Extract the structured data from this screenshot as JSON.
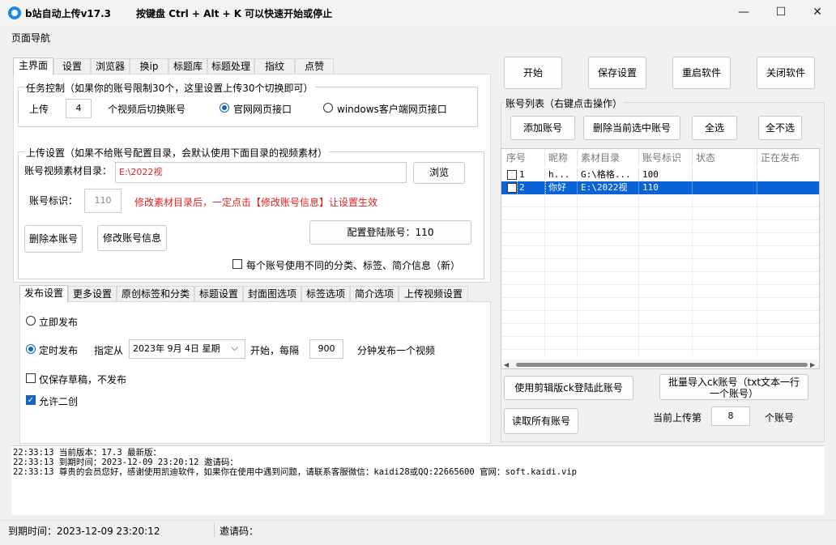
{
  "window": {
    "title": "b站自动上传v17.3",
    "hint": "按键盘 Ctrl + Alt + K  可以快速开始或停止",
    "minimize": "—",
    "maximize": "☐",
    "close": "✕"
  },
  "menu": {
    "nav": "页面导航"
  },
  "top_tabs": [
    "主界面",
    "设置",
    "浏览器",
    "换ip",
    "标题库",
    "标题处理",
    "指纹",
    "点赞"
  ],
  "task_control": {
    "title": "任务控制（如果你的账号限制30个，这里设置上传30个切换即可）",
    "upload_label": "上传",
    "upload_count": "4",
    "switch_text": "个视频后切换账号",
    "radio_official": "官网网页接口",
    "radio_windows": "windows客户端网页接口"
  },
  "upload_settings": {
    "title": "上传设置（如果不给账号配置目录，会默认使用下面目录的视频素材）",
    "dir_label": "账号视频素材目录：",
    "dir_value": "E:\\2022视",
    "browse_button": "浏览",
    "account_id_label": "账号标识：",
    "account_id_value": "110",
    "warning": "修改素材目录后，一定点击【修改账号信息】让设置生效",
    "delete_button": "删除本账号",
    "modify_button": "修改账号信息",
    "config_login_button": "配置登陆账号：110",
    "checkbox_different": "每个账号使用不同的分类、标签、简介信息（新）"
  },
  "bottom_tabs": [
    "发布设置",
    "更多设置",
    "原创标签和分类",
    "标题设置",
    "封面图选项",
    "标签选项",
    "简介选项",
    "上传视频设置"
  ],
  "publish": {
    "immediate": "立即发布",
    "scheduled": "定时发布",
    "specify_from": "指定从",
    "date_value": "2023年 9月 4日 星期",
    "start_every": "开始，每隔",
    "interval": "900",
    "interval_suffix": "分钟发布一个视频",
    "draft_only": "仅保存草稿，不发布",
    "allow_remix": "允许二创"
  },
  "right": {
    "start_button": "开始",
    "save_button": "保存设置",
    "restart_button": "重启软件",
    "close_button": "关闭软件",
    "account_list_title": "账号列表（右键点击操作）",
    "add_account": "添加账号",
    "delete_selected": "删除当前选中账号",
    "select_all": "全选",
    "select_none": "全不选",
    "columns": [
      "序号",
      "昵称",
      "素材目录",
      "账号标识",
      "状态",
      "正在发布"
    ],
    "rows": [
      {
        "no": "1",
        "nick": "h...",
        "dir": "G:\\格格...",
        "id": "100",
        "status": "",
        "publishing": "",
        "selected": false
      },
      {
        "no": "2",
        "nick": "你好",
        "dir": "E:\\2022视",
        "id": "110",
        "status": "",
        "publishing": "",
        "selected": true
      }
    ],
    "jianying_login": "使用剪辑版ck登陆此账号",
    "batch_import": "批量导入ck账号（txt文本一行一个账号）",
    "read_all": "读取所有账号",
    "current_upload_label": "当前上传第",
    "current_upload_value": "8",
    "current_upload_suffix": "个账号"
  },
  "log": [
    "22:33:13 当前版本：17.3    最新版：",
    "22:33:13 到期时间：2023-12-09 23:20:12 邀请码：",
    "22:33:13 尊贵的会员您好，感谢使用凯迪软件，如果你在使用中遇到问题，请联系客服微信：kaidi28或QQ:22665600 官网：soft.kaidi.vip"
  ],
  "statusbar": {
    "expire": "到期时间：2023-12-09 23:20:12",
    "invite": "邀请码："
  },
  "colors": {
    "accent": "#1565c0",
    "selected_row": "#0a64d8",
    "warning": "#e02020"
  }
}
